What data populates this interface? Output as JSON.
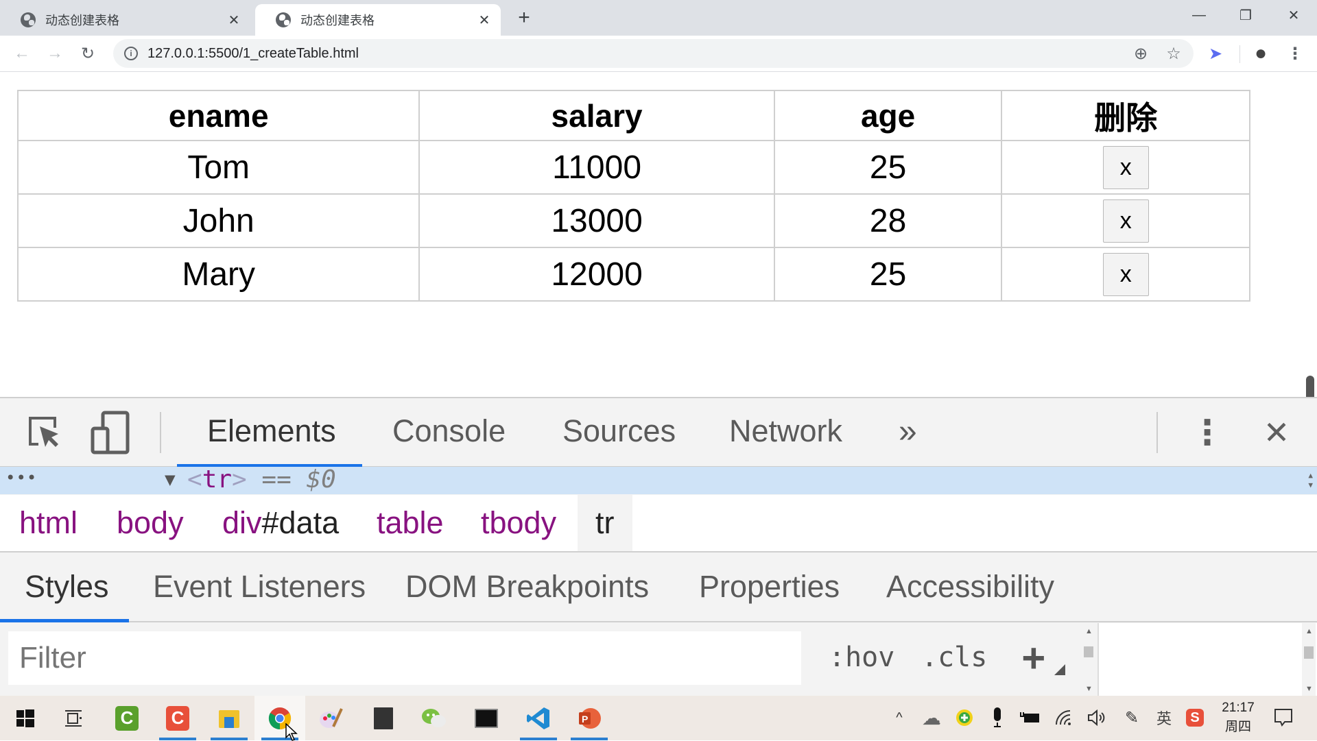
{
  "browser": {
    "tabs": [
      {
        "title": "动态创建表格",
        "active": false,
        "close_label": "✕"
      },
      {
        "title": "动态创建表格",
        "active": true,
        "close_label": "✕"
      }
    ],
    "new_tab_label": "+",
    "window_controls": {
      "minimize": "—",
      "restore": "❐",
      "close": "✕"
    },
    "nav": {
      "back": "←",
      "forward": "→",
      "reload": "↻"
    },
    "address": {
      "info_icon": "i",
      "url": "127.0.0.1:5500/1_createTable.html"
    },
    "toolbar_icons": {
      "zoom": "⊕",
      "bookmark": "☆",
      "extension": "➤",
      "profile": "●",
      "menu": "⋮"
    }
  },
  "page": {
    "table": {
      "headers": [
        "ename",
        "salary",
        "age",
        "删除"
      ],
      "rows": [
        {
          "ename": "Tom",
          "salary": "11000",
          "age": "25",
          "delete_label": "x"
        },
        {
          "ename": "John",
          "salary": "13000",
          "age": "28",
          "delete_label": "x"
        },
        {
          "ename": "Mary",
          "salary": "12000",
          "age": "25",
          "delete_label": "x"
        }
      ]
    }
  },
  "devtools": {
    "tabs": [
      {
        "label": "Elements",
        "selected": true
      },
      {
        "label": "Console",
        "selected": false
      },
      {
        "label": "Sources",
        "selected": false
      },
      {
        "label": "Network",
        "selected": false
      }
    ],
    "more_tabs_label": "»",
    "menu_label": "⋮",
    "close_label": "✕",
    "selected_node": {
      "dots": "•••",
      "toggle": "▼",
      "open_bracket": "<",
      "tag": "tr",
      "close_bracket": ">",
      "equals": "==",
      "ref": "$0"
    },
    "breadcrumb": [
      {
        "tag": "html",
        "id": ""
      },
      {
        "tag": "body",
        "id": ""
      },
      {
        "tag": "div",
        "id": "#data"
      },
      {
        "tag": "table",
        "id": ""
      },
      {
        "tag": "tbody",
        "id": ""
      },
      {
        "tag": "tr",
        "id": ""
      }
    ],
    "subtabs": [
      {
        "label": "Styles",
        "selected": true
      },
      {
        "label": "Event Listeners",
        "selected": false
      },
      {
        "label": "DOM Breakpoints",
        "selected": false
      },
      {
        "label": "Properties",
        "selected": false
      },
      {
        "label": "Accessibility",
        "selected": false
      }
    ],
    "filter": {
      "placeholder": "Filter",
      "value": ""
    },
    "hov_label": ":hov",
    "cls_label": ".cls",
    "add_rule_label": "+"
  },
  "taskbar": {
    "apps": [
      {
        "name": "start",
        "glyph": "⊞"
      },
      {
        "name": "task-view",
        "glyph": "⧉"
      },
      {
        "name": "camtasia-green",
        "glyph": "C",
        "color": "#5aa02c"
      },
      {
        "name": "camtasia-red",
        "glyph": "C",
        "color": "#e8503a",
        "running": true
      },
      {
        "name": "file-explorer",
        "glyph": "▬",
        "color": "#f0c22c",
        "running": true
      },
      {
        "name": "chrome",
        "glyph": "◉",
        "color": "#db4437",
        "running": true,
        "active": true
      },
      {
        "name": "paint",
        "glyph": "🖌",
        "color": "#c9a9e0"
      },
      {
        "name": "sticky-notes",
        "glyph": "◩",
        "color": "#333333"
      },
      {
        "name": "wechat",
        "glyph": "●",
        "color": "#7bc043"
      },
      {
        "name": "terminal",
        "glyph": "▮",
        "color": "#111111"
      },
      {
        "name": "vscode",
        "glyph": "≺",
        "color": "#1f8ad2",
        "running": true
      },
      {
        "name": "powerpoint",
        "glyph": "P",
        "color": "#d24726",
        "running": true
      }
    ],
    "tray": {
      "chevron": "^",
      "cloud": "☁",
      "security": "+",
      "mic": "🎤",
      "battery": "▭",
      "wifi": "◜",
      "volume": "🔊",
      "pen": "✎",
      "ime": "英",
      "sogou": "S"
    },
    "clock": {
      "time": "21:17",
      "day": "周四"
    },
    "notification_icon": "🗨"
  }
}
